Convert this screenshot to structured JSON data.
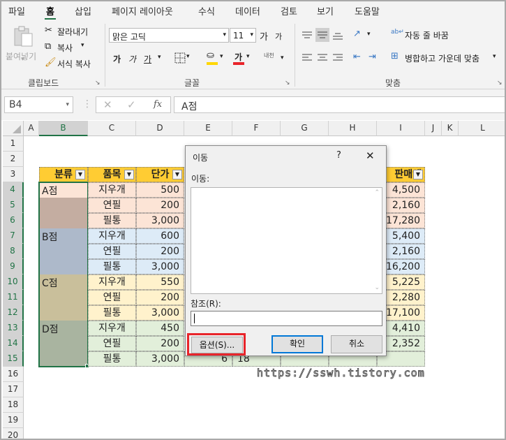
{
  "tabs": [
    "파일",
    "홈",
    "삽입",
    "페이지 레이아웃",
    "수식",
    "데이터",
    "검토",
    "보기",
    "도움말"
  ],
  "ribbon": {
    "paste": "붙여넣기",
    "cut": "잘라내기",
    "copy": "복사",
    "format_painter": "서식 복사",
    "clipboard": "클립보드",
    "font_name": "맑은 고딕",
    "font_size": "11",
    "grow": "가",
    "shrink": "가",
    "bold": "가",
    "italic": "가",
    "underline": "가",
    "font_color_glyph": "가",
    "phonetic": "내천",
    "font_group": "글꼴",
    "wrap_text": "자동 줄 바꿈",
    "merge_center": "병합하고 가운데 맞춤",
    "align_group": "맞춤"
  },
  "formula_bar": {
    "name_box": "B4",
    "formula": "A점",
    "fx": "fx"
  },
  "columns": [
    "A",
    "B",
    "C",
    "D",
    "E",
    "F",
    "G",
    "H",
    "I",
    "J",
    "K",
    "L"
  ],
  "rows": [
    "1",
    "2",
    "3",
    "4",
    "5",
    "6",
    "7",
    "8",
    "9",
    "10",
    "11",
    "12",
    "13",
    "14",
    "15",
    "16",
    "17",
    "18",
    "19",
    "20"
  ],
  "table": {
    "headers": {
      "b": "분류",
      "c": "품목",
      "d": "단가",
      "i": "판매액"
    },
    "groups": [
      "A점",
      "B점",
      "C점",
      "D점"
    ],
    "items": [
      "지우개",
      "연필",
      "필통",
      "지우개",
      "연필",
      "필통",
      "지우개",
      "연필",
      "필통",
      "지우개",
      "연필",
      "필통"
    ],
    "prices": [
      "500",
      "200",
      "3,000",
      "600",
      "200",
      "3,000",
      "550",
      "200",
      "3,000",
      "450",
      "200",
      "3,000"
    ],
    "sales": [
      "4,500",
      "2,160",
      "17,280",
      "5,400",
      "2,160",
      "16,200",
      "5,225",
      "2,280",
      "17,100",
      "4,410",
      "2,352",
      ""
    ],
    "e15": "6",
    "f15": "18"
  },
  "dialog": {
    "title": "이동",
    "help": "?",
    "close": "✕",
    "goto_label": "이동:",
    "ref_label": "참조(R):",
    "options": "옵션(S)...",
    "ok": "확인",
    "cancel": "취소"
  },
  "watermark": "https://sswh.tistory.com",
  "colors": {
    "accent": "#217346",
    "header_yellow": "#ffcc33",
    "highlight_red": "#e8242a"
  }
}
